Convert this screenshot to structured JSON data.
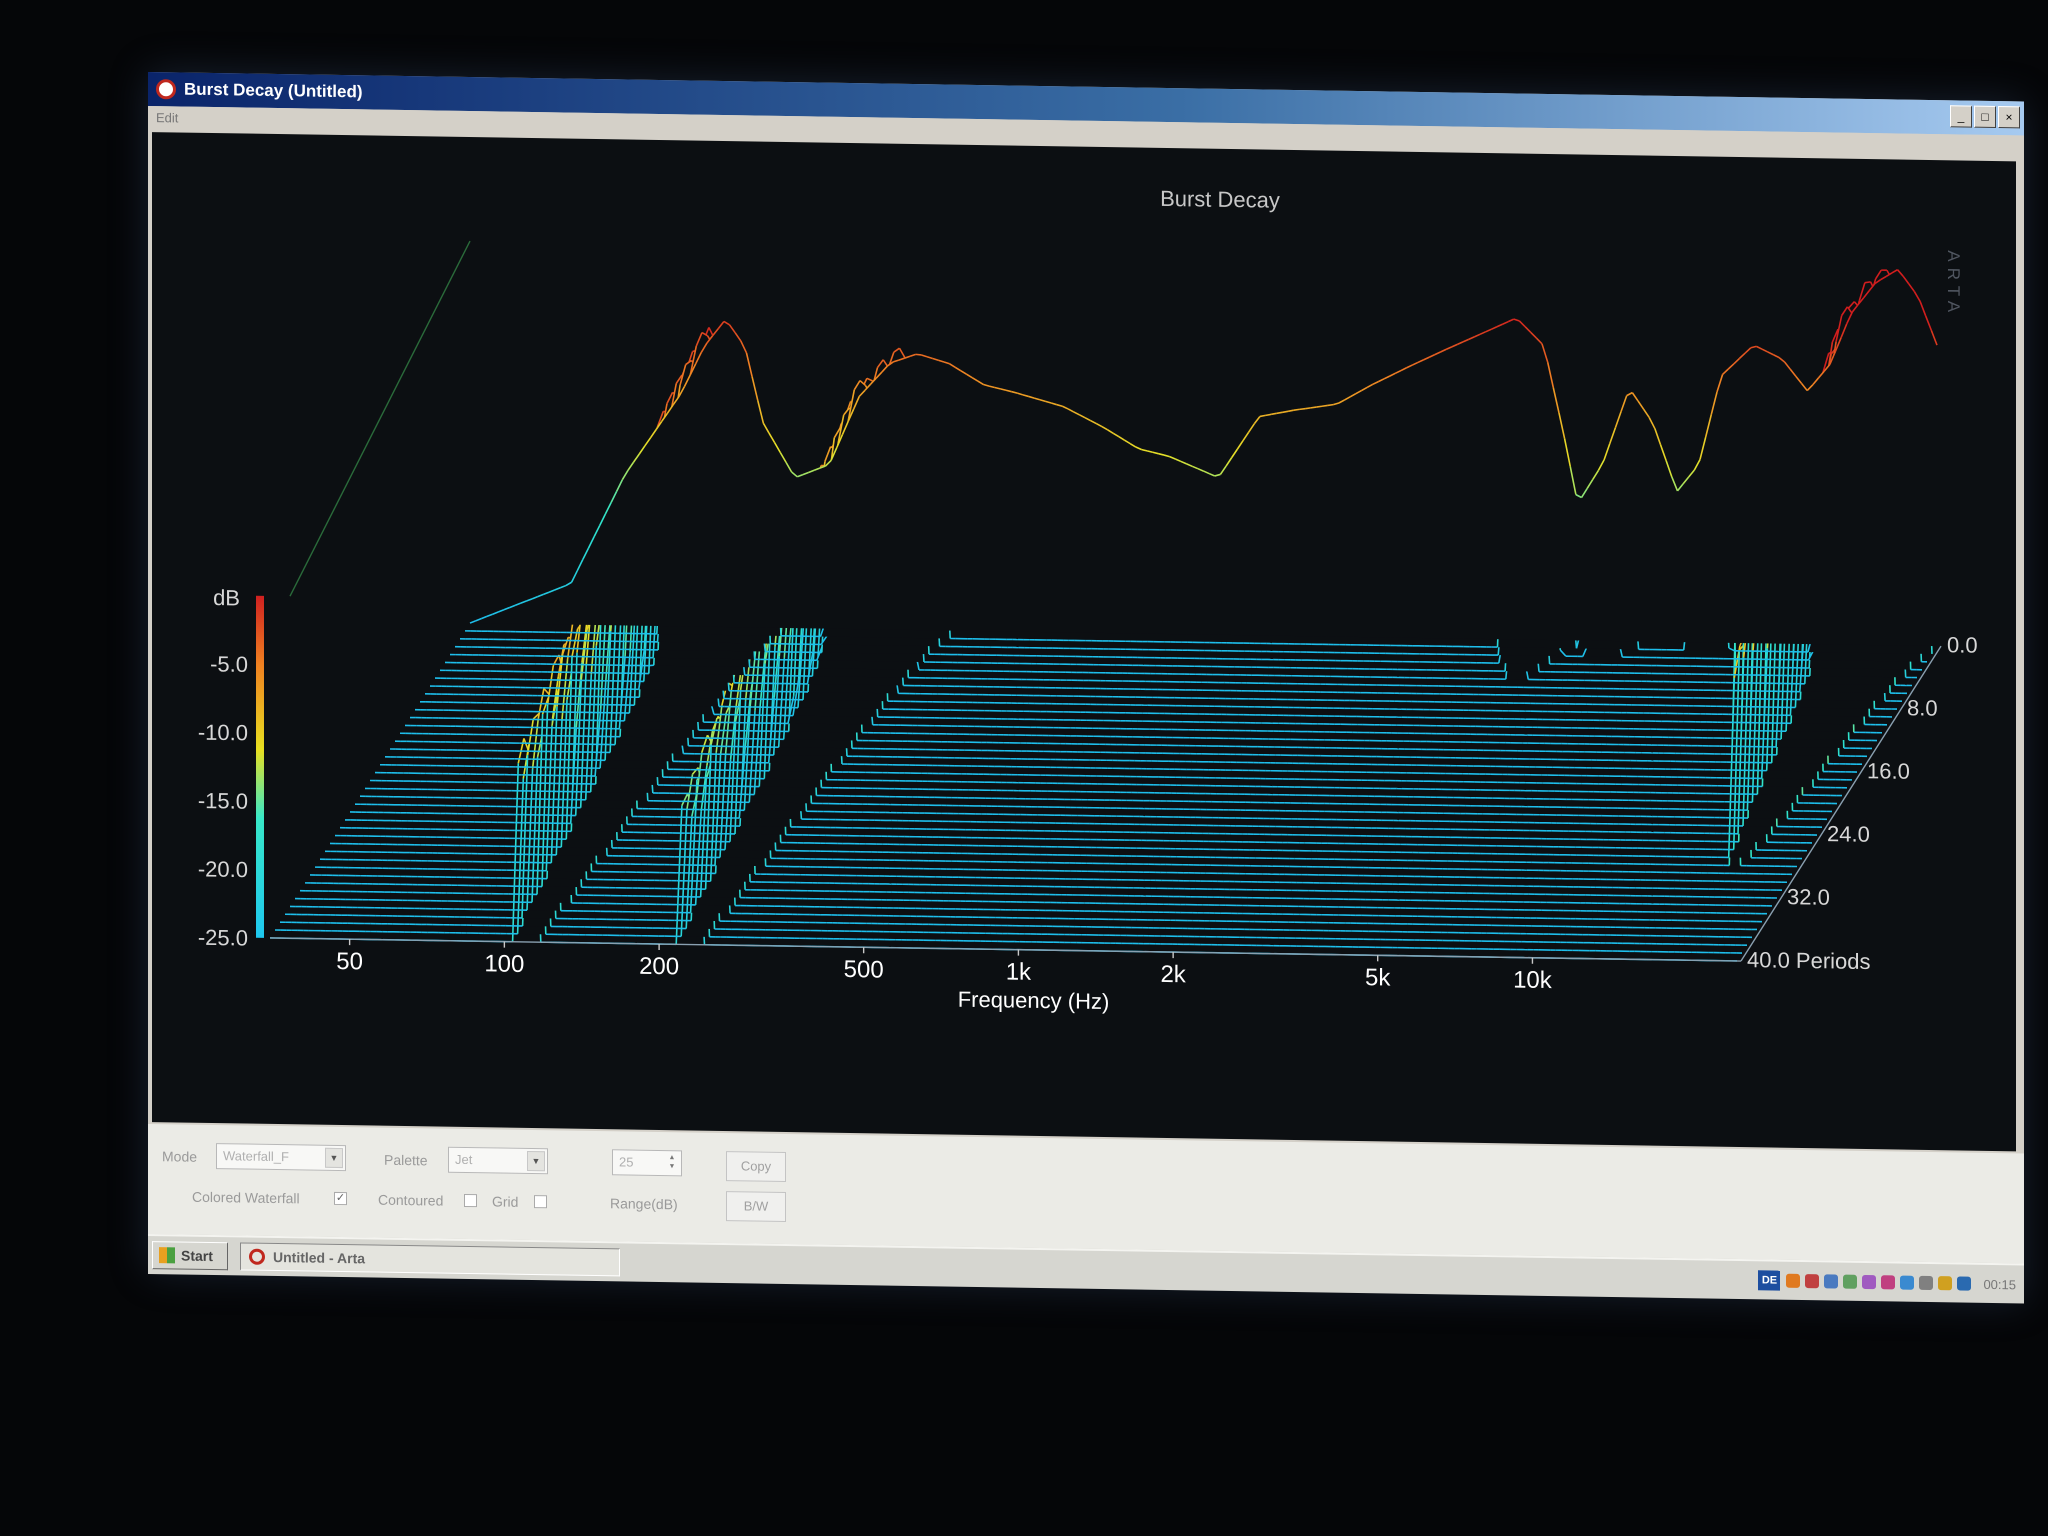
{
  "window": {
    "title": "Burst Decay  (Untitled)",
    "menu": "Edit"
  },
  "chart_data": {
    "type": "waterfall",
    "title": "Burst Decay",
    "watermark": "ARTA",
    "xlabel": "Frequency (Hz)",
    "x_scale": "log",
    "xlim": [
      35,
      25000
    ],
    "x_ticks": [
      "50",
      "100",
      "200",
      "500",
      "1k",
      "2k",
      "5k",
      "10k"
    ],
    "x_tick_values": [
      50,
      100,
      200,
      500,
      1000,
      2000,
      5000,
      10000
    ],
    "ylabel": "dB",
    "ylim": [
      -25,
      0
    ],
    "y_ticks": [
      "-5.0",
      "-10.0",
      "-15.0",
      "-20.0",
      "-25.0"
    ],
    "y_tick_values": [
      -5,
      -10,
      -15,
      -20,
      -25
    ],
    "zlabel": "Periods",
    "z_ticks": [
      "0.0",
      "8.0",
      "16.0",
      "24.0",
      "32.0",
      "40.0"
    ],
    "z_tick_values": [
      0,
      8,
      16,
      24,
      32,
      40
    ],
    "z_unit_label": "Periods",
    "palette": "Jet",
    "first_slice": {
      "freq": [
        35,
        55,
        70,
        90,
        100,
        110,
        120,
        130,
        150,
        175,
        200,
        230,
        260,
        300,
        350,
        400,
        500,
        600,
        700,
        800,
        1000,
        1200,
        1400,
        1700,
        2000,
        2400,
        2800,
        3200,
        3800,
        4300,
        4700,
        5000,
        5600,
        6300,
        7000,
        7800,
        8600,
        9500,
        11000,
        12500,
        14000,
        15500,
        17000,
        19000,
        21000,
        23000,
        25000
      ],
      "db": [
        -25,
        -22,
        -14,
        -8,
        -4.5,
        -2.5,
        -4.5,
        -10,
        -14,
        -13,
        -8,
        -5.5,
        -4.8,
        -5.5,
        -7,
        -7.5,
        -8.5,
        -10,
        -11.5,
        -12,
        -13.5,
        -9,
        -8.5,
        -8,
        -6.5,
        -5,
        -3.8,
        -2.8,
        -1.5,
        -3.5,
        -10,
        -15,
        -12,
        -6.5,
        -9,
        -14,
        -12,
        -5.5,
        -3.2,
        -4.2,
        -6.5,
        -4.5,
        -0.8,
        1.5,
        2.5,
        0.5,
        -3
      ]
    },
    "decay": {
      "slice_count": 40,
      "resonances": [
        {
          "freq": 110,
          "decay_periods": 40
        },
        {
          "freq": 230,
          "decay_periods": 40
        },
        {
          "freq": 4300,
          "decay_periods": 5
        },
        {
          "freq": 5800,
          "decay_periods": 3
        },
        {
          "freq": 9000,
          "decay_periods": 2
        },
        {
          "freq": 19000,
          "decay_periods": 26
        }
      ]
    }
  },
  "controls": {
    "mode_label": "Mode",
    "mode_value": "Waterfall_F",
    "palette_label": "Palette",
    "palette_value": "Jet",
    "range_value": "25",
    "range_label": "Range(dB)",
    "copy_label": "Copy",
    "bw_label": "B/W",
    "colored_waterfall_label": "Colored Waterfall",
    "colored_waterfall_checked": true,
    "contoured_label": "Contoured",
    "contoured_checked": false,
    "grid_label": "Grid",
    "grid_checked": false
  },
  "taskbar": {
    "start_label": "Start",
    "task_label": "Untitled - Arta",
    "lang": "DE",
    "clock": "00:15",
    "tray_colors": [
      "#e07a20",
      "#c04040",
      "#4a7ac0",
      "#60a060",
      "#a05ac0",
      "#c04080",
      "#3a8ad0",
      "#808080",
      "#d0a020",
      "#2a6ab0"
    ]
  }
}
